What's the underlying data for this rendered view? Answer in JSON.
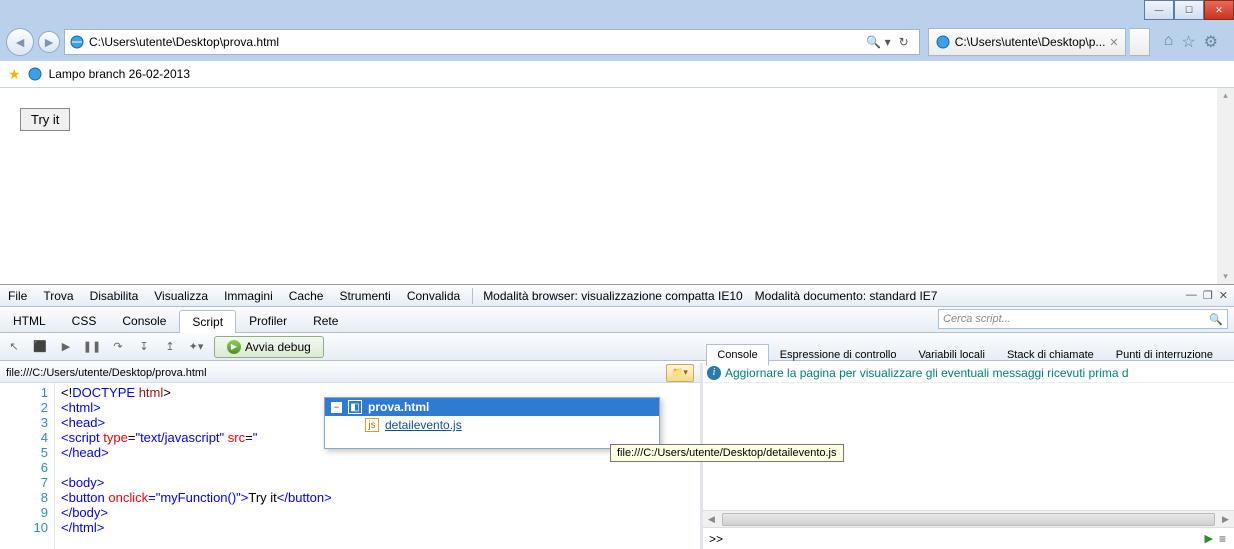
{
  "window": {
    "url": "C:\\Users\\utente\\Desktop\\prova.html",
    "tab_title": "C:\\Users\\utente\\Desktop\\p..."
  },
  "favorites": {
    "item": "Lampo branch 26-02-2013"
  },
  "page": {
    "button": "Try it"
  },
  "devtools": {
    "menu": [
      "File",
      "Trova",
      "Disabilita",
      "Visualizza",
      "Immagini",
      "Cache",
      "Strumenti",
      "Convalida"
    ],
    "browser_mode_label": "Modalità browser:",
    "browser_mode_value": "visualizzazione compatta IE10",
    "doc_mode_label": "Modalità documento:",
    "doc_mode_value": "standard IE7",
    "tabs": [
      "HTML",
      "CSS",
      "Console",
      "Script",
      "Profiler",
      "Rete"
    ],
    "active_tab": 3,
    "search_placeholder": "Cerca script...",
    "debug_btn": "Avvia debug",
    "subtabs": [
      "Console",
      "Espressione di controllo",
      "Variabili locali",
      "Stack di chiamate",
      "Punti di interruzione"
    ],
    "active_subtab": 0,
    "script_path": "file:///C:/Users/utente/Desktop/prova.html",
    "code_lines": [
      {
        "n": 1,
        "html": "&lt;!<span class='kw'>DOCTYPE</span> <span class='tag'>html</span>&gt;"
      },
      {
        "n": 2,
        "html": "<span class='kw'>&lt;html&gt;</span>"
      },
      {
        "n": 3,
        "html": "<span class='kw'>&lt;head&gt;</span>"
      },
      {
        "n": 4,
        "html": "<span class='kw'>&lt;script</span> <span class='attr'>type</span>=<span class='str'>\"text/javascript\"</span> <span class='attr'>src</span>=<span class='str'>\""
      },
      {
        "n": 5,
        "html": "<span class='kw'>&lt;/head&gt;</span>"
      },
      {
        "n": 6,
        "html": ""
      },
      {
        "n": 7,
        "html": "<span class='kw'>&lt;body&gt;</span>"
      },
      {
        "n": 8,
        "html": "<span class='kw'>&lt;button</span> <span class='attr'>onclick</span>=<span class='str'>\"myFunction()\"</span><span class='kw'>&gt;</span><span class='txt'>Try it</span><span class='kw'>&lt;/button&gt;</span>"
      },
      {
        "n": 9,
        "html": "<span class='kw'>&lt;/body&gt;</span>"
      },
      {
        "n": 10,
        "html": "<span class='kw'>&lt;/html&gt;</span>"
      }
    ],
    "info_msg": "Aggiornare la pagina per visualizzare gli eventuali messaggi ricevuti prima d",
    "prompt": ">>",
    "popup": {
      "root": "prova.html",
      "child": "detailevento.js"
    },
    "tooltip": "file:///C:/Users/utente/Desktop/detailevento.js"
  }
}
